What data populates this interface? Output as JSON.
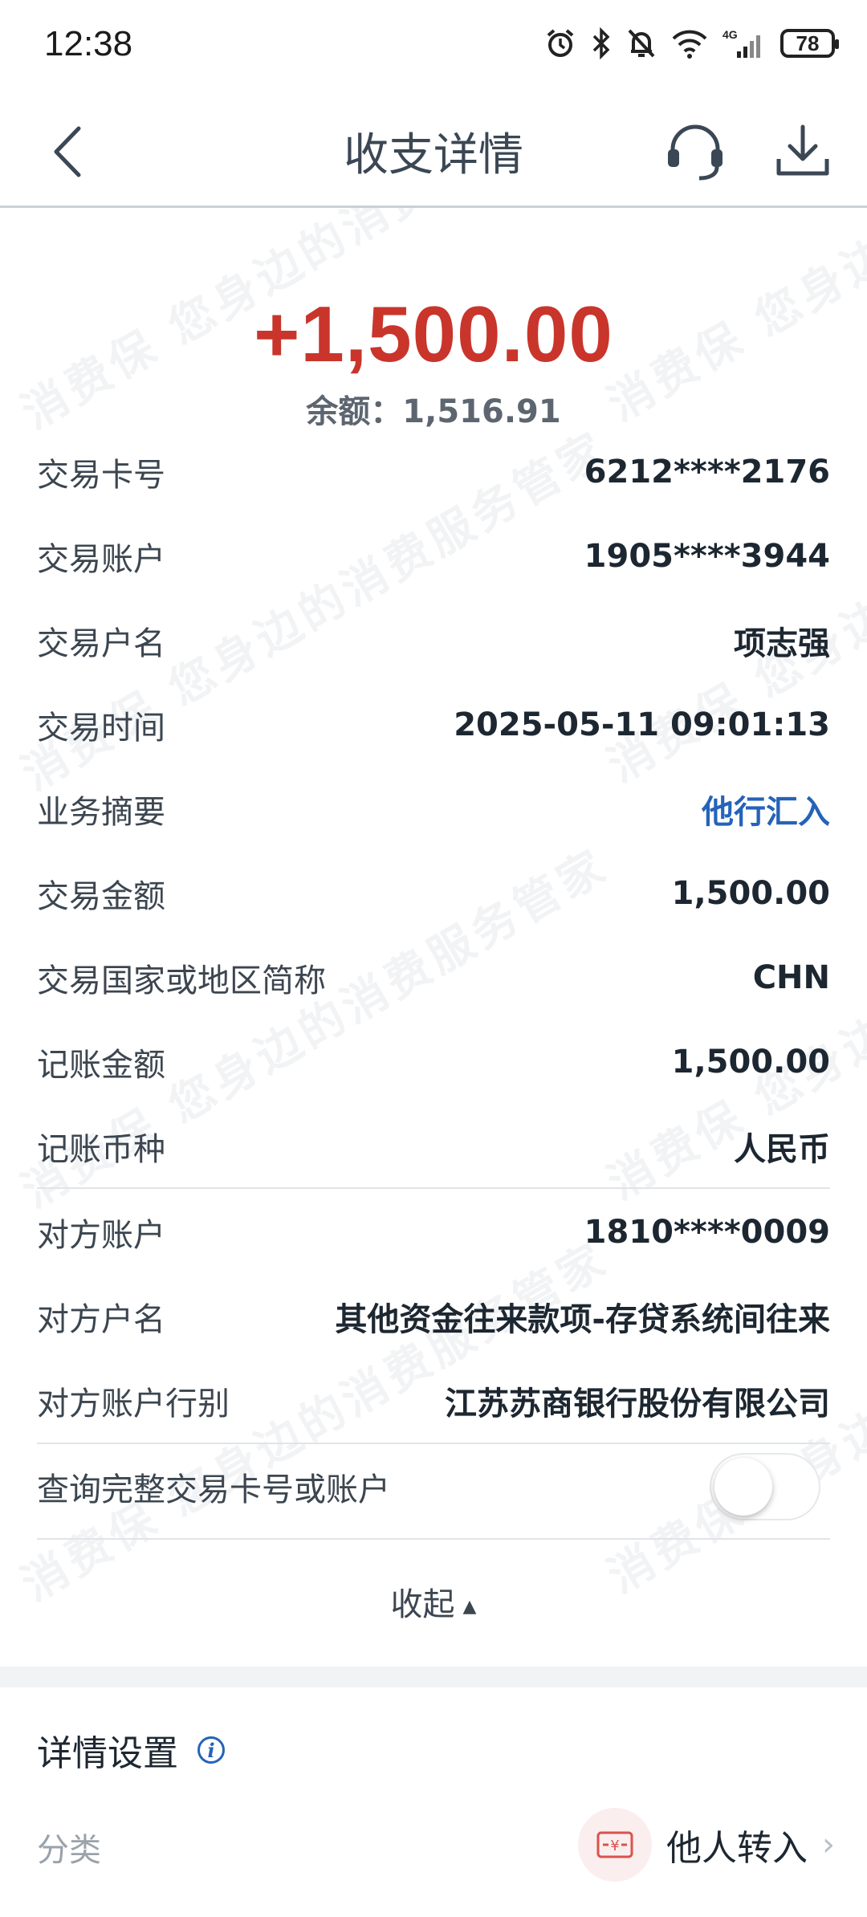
{
  "status_bar": {
    "time": "12:38",
    "network": "4G",
    "battery": "78"
  },
  "header": {
    "title": "收支详情"
  },
  "summary": {
    "amount": "+1,500.00",
    "balance_label": "余额：",
    "balance_value": "1,516.91",
    "amount_color": "#c9352b"
  },
  "details": [
    {
      "label": "交易卡号",
      "value": "6212****2176"
    },
    {
      "label": "交易账户",
      "value": "1905****3944"
    },
    {
      "label": "交易户名",
      "value": "项志强"
    },
    {
      "label": "交易时间",
      "value": "2025-05-11 09:01:13"
    },
    {
      "label": "业务摘要",
      "value": "他行汇入"
    },
    {
      "label": "交易金额",
      "value": "1,500.00"
    },
    {
      "label": "交易国家或地区简称",
      "value": "CHN"
    },
    {
      "label": "记账金额",
      "value": "1,500.00"
    },
    {
      "label": "记账币种",
      "value": "人民币"
    }
  ],
  "counterparty": [
    {
      "label": "对方账户",
      "value": "1810****0009"
    },
    {
      "label": "对方户名",
      "value": "其他资金往来款项-存贷系统间往来"
    },
    {
      "label": "对方账户行别",
      "value": "江苏苏商银行股份有限公司"
    }
  ],
  "query_full": {
    "label": "查询完整交易卡号或账户",
    "enabled": false
  },
  "collapse_label": "收起",
  "settings": {
    "title": "详情设置",
    "category_label": "分类",
    "category_value": "他人转入"
  },
  "watermark": "消费保 您身边的消费服务管家",
  "colors": {
    "link": "#2563b8",
    "title": "#3b4754"
  }
}
